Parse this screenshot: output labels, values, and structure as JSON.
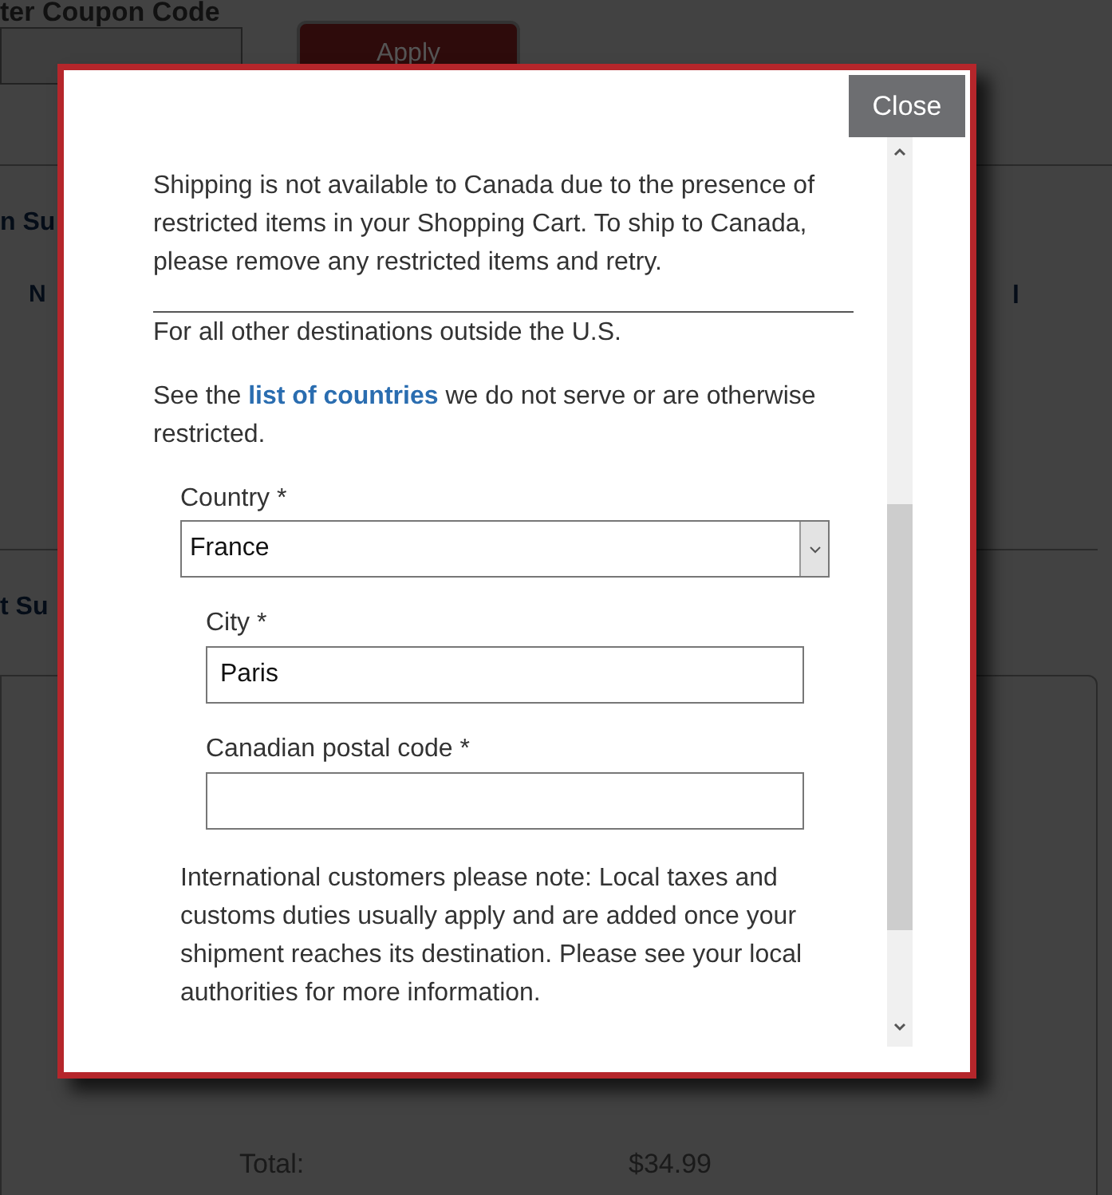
{
  "page": {
    "coupon_label": "ter Coupon Code",
    "apply_button": "Apply",
    "heading_1": "n Su",
    "column_1": "N",
    "column_2": "l",
    "heading_2": "t Su",
    "summary": [
      {
        "label": "Total:",
        "value": "$34.99"
      }
    ]
  },
  "modal": {
    "close_button": "Close",
    "notice": "Shipping is not available to Canada due to the presence of restricted items in your Shopping Cart. To ship to Canada, please remove any restricted items and retry.",
    "other_destinations": "For all other destinations outside the U.S.",
    "restricted": {
      "before": "See the",
      "link": "list of countries",
      "after": "we do not serve or are otherwise restricted."
    },
    "fields": [
      {
        "kind": "select",
        "label": "Country *",
        "value": "France"
      },
      {
        "kind": "text",
        "label": "City *",
        "value": "Paris"
      },
      {
        "kind": "text",
        "label": "Canadian postal code *"
      }
    ],
    "note": "International customers please note: Local taxes and customs duties usually apply and are added once your shipment reaches its destination. Please see your local authorities for more information."
  }
}
